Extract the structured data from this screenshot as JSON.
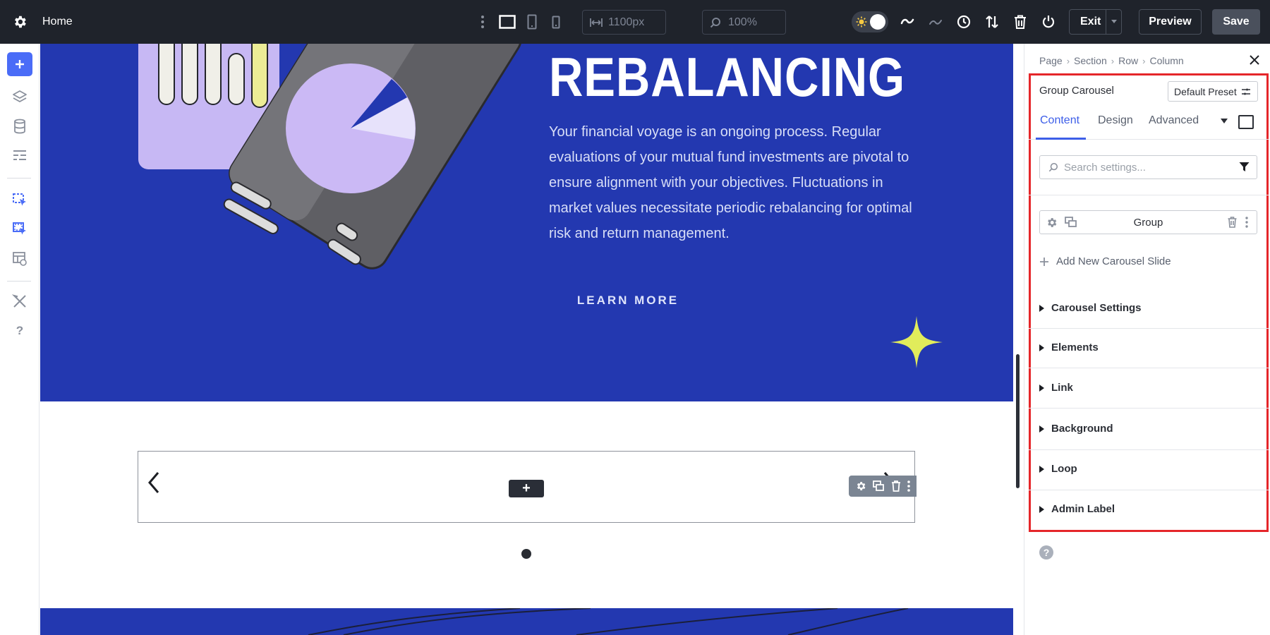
{
  "topbar": {
    "title": "Home",
    "width_value": "1100px",
    "zoom_value": "100%",
    "exit_label": "Exit",
    "preview_label": "Preview",
    "save_label": "Save"
  },
  "canvas": {
    "hero": {
      "title": "REBALANCING",
      "body": "Your financial voyage is an ongoing process. Regular evaluations of your mutual fund investments are pivotal to ensure alignment with your objectives. Fluctuations in market values necessitate periodic rebalancing for optimal risk and return management.",
      "cta": "LEARN MORE"
    },
    "carousel": {
      "add_label": "+"
    }
  },
  "panel": {
    "breadcrumb": [
      "Page",
      "Section",
      "Row",
      "Column"
    ],
    "title": "Group Carousel",
    "preset": "Default Preset",
    "tabs": [
      "Content",
      "Design",
      "Advanced"
    ],
    "active_tab": "Content",
    "search_placeholder": "Search settings...",
    "group_label": "Group",
    "add_slide_label": "Add New Carousel Slide",
    "accordion": [
      "Carousel Settings",
      "Elements",
      "Link",
      "Background",
      "Loop",
      "Admin Label"
    ],
    "help_label": "?"
  },
  "colors": {
    "hero_bg": "#2338b0",
    "accent": "#3d5ee8",
    "highlight": "#e5262a",
    "star": "#e1ec5b"
  }
}
